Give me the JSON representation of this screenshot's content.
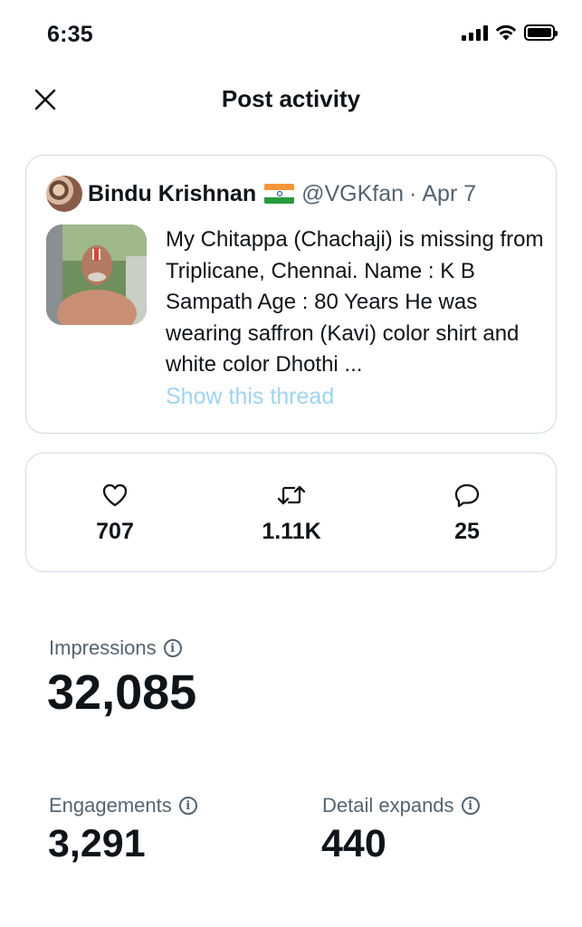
{
  "status_bar": {
    "time": "6:35"
  },
  "header": {
    "title": "Post activity"
  },
  "post": {
    "author_name": "Bindu Krishnan",
    "handle": "@VGKfan",
    "separator": "·",
    "date": "Apr 7",
    "text": "My Chitappa (Chachaji) is missing from Triplicane, Chennai.  Name : K B Sampath Age : 80 Years He was wearing saffron (Kavi) color shirt and white color Dhothi   ...",
    "show_thread": "Show this thread"
  },
  "stats": {
    "likes": "707",
    "reposts": "1.11K",
    "replies": "25"
  },
  "metrics": {
    "impressions_label": "Impressions",
    "impressions_value": "32,085",
    "engagements_label": "Engagements",
    "engagements_value": "3,291",
    "detail_expands_label": "Detail expands",
    "detail_expands_value": "440"
  },
  "icons": {
    "close": "close-icon",
    "like": "heart-icon",
    "repost": "repost-icon",
    "reply": "reply-icon",
    "info": "info-icon",
    "flag": "india-flag-icon"
  },
  "colors": {
    "link": "#9dd4f2",
    "secondary_text": "#536471",
    "border": "#cfd9de"
  }
}
